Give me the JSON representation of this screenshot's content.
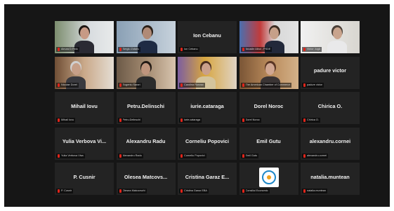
{
  "participants": [
    {
      "name": "Ainura D.Fedo",
      "display": "",
      "muted": true,
      "video": true
    },
    {
      "name": "Sergiu Zotariu",
      "display": "",
      "muted": true,
      "video": true,
      "active": true
    },
    {
      "name": "Ion Cebanu",
      "display": "Ion Cebanu",
      "muted": true,
      "video": false
    },
    {
      "name": "Arcadie Albul - PSDE",
      "display": "",
      "muted": true,
      "video": true
    },
    {
      "name": "Victor Jugă",
      "display": "",
      "muted": true,
      "video": true
    },
    {
      "name": "Nicolae Dorel",
      "display": "",
      "muted": true,
      "video": true
    },
    {
      "name": "Eugeniu Sarari",
      "display": "",
      "muted": true,
      "video": true
    },
    {
      "name": "Carolina Rusnac",
      "display": "",
      "muted": true,
      "video": true
    },
    {
      "name": "The American Chamber of Commerce",
      "display": "",
      "muted": true,
      "video": true
    },
    {
      "name": "padure victor",
      "display": "padure victor",
      "muted": true,
      "video": false
    },
    {
      "name": "Mihail Iovu",
      "display": "Mihail Iovu",
      "muted": true,
      "video": false
    },
    {
      "name": "Petru.Delinschi",
      "display": "Petru.Delinschi",
      "muted": true,
      "video": false
    },
    {
      "name": "iurie.cataraga",
      "display": "iurie.cataraga",
      "muted": true,
      "video": false
    },
    {
      "name": "Dorel Noroc",
      "display": "Dorel Noroc",
      "muted": true,
      "video": false
    },
    {
      "name": "Chirica O.",
      "display": "Chirica O.",
      "muted": true,
      "video": false
    },
    {
      "name": "Yulia Verbova Visa",
      "display": "Yulia Verbova Vi...",
      "muted": true,
      "video": false
    },
    {
      "name": "Alexandru Radu",
      "display": "Alexandru Radu",
      "muted": true,
      "video": false
    },
    {
      "name": "Corneliu Popovici",
      "display": "Corneliu Popovici",
      "muted": true,
      "video": false
    },
    {
      "name": "Emil Gutu",
      "display": "Emil Gutu",
      "muted": true,
      "video": false
    },
    {
      "name": "alexandru.cornei",
      "display": "alexandru.cornei",
      "muted": true,
      "video": false
    },
    {
      "name": "P. Cusnir",
      "display": "P. Cusnir",
      "muted": true,
      "video": false
    },
    {
      "name": "Olesea Matcovschi",
      "display": "Olesea Matcovs...",
      "muted": true,
      "video": false
    },
    {
      "name": "Cristina Garaz EBA",
      "display": "Cristina Garaz E...",
      "muted": true,
      "video": false
    },
    {
      "name": "Consiliul Economic",
      "display": "",
      "muted": true,
      "video": false,
      "logo": true
    },
    {
      "name": "natalia.muntean",
      "display": "natalia.muntean",
      "muted": true,
      "video": false
    }
  ],
  "colors": {
    "frame": "#161616",
    "tile": "#232323",
    "muted_icon": "#e0251b",
    "active_border": "#e8d33a"
  }
}
